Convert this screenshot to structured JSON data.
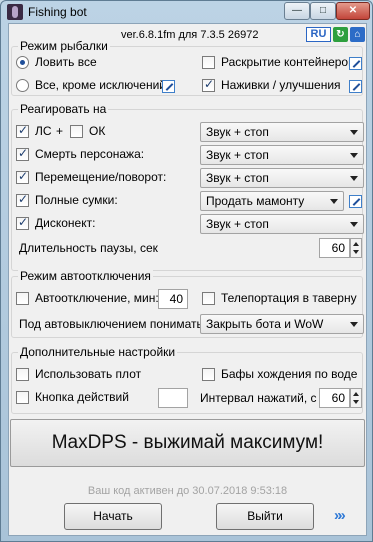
{
  "window": {
    "title": "Fishing bot",
    "min_glyph": "—",
    "max_glyph": "□",
    "close_glyph": "✕"
  },
  "header": {
    "version": "ver.6.8.1fm для 7.3.5 26972",
    "lang_badge": "RU"
  },
  "fishing_mode": {
    "title": "Режим рыбалки",
    "catch_all": "Ловить все",
    "all_except": "Все, кроме исключений",
    "open_containers": "Раскрытие контейнеров",
    "lures_upgrades": "Наживки / улучшения"
  },
  "react": {
    "title": "Реагировать на",
    "ls": "ЛС",
    "plus": "+",
    "ok": "ОК",
    "char_death": "Смерть персонажа:",
    "move_turn": "Перемещение/поворот:",
    "full_bags": "Полные сумки:",
    "disconnect": "Дисконект:",
    "pause_len": "Длительность паузы, сек",
    "sound_stop": "Звук + стоп",
    "sell_mammoth": "Продать мамонту",
    "pause_value": "60"
  },
  "auto_off": {
    "title": "Режим автоотключения",
    "auto_off_min": "Автоотключение, мин:",
    "auto_off_value": "40",
    "teleport_tavern": "Телепортация в таверну",
    "understand_label": "Под автовыключением понимать",
    "understand_value": "Закрыть бота и WoW"
  },
  "extra": {
    "title": "Дополнительные настройки",
    "use_raft": "Использовать плот",
    "water_walk": "Бафы хождения по воде",
    "action_key": "Кнопка действий",
    "press_interval": "Интервал нажатий, с",
    "interval_value": "60"
  },
  "promo": "MaxDPS - выжимай максимум!",
  "code_status": "Ваш код активен до 30.07.2018 9:53:18",
  "buttons": {
    "start": "Начать",
    "exit": "Выйти",
    "forward": "»»"
  }
}
